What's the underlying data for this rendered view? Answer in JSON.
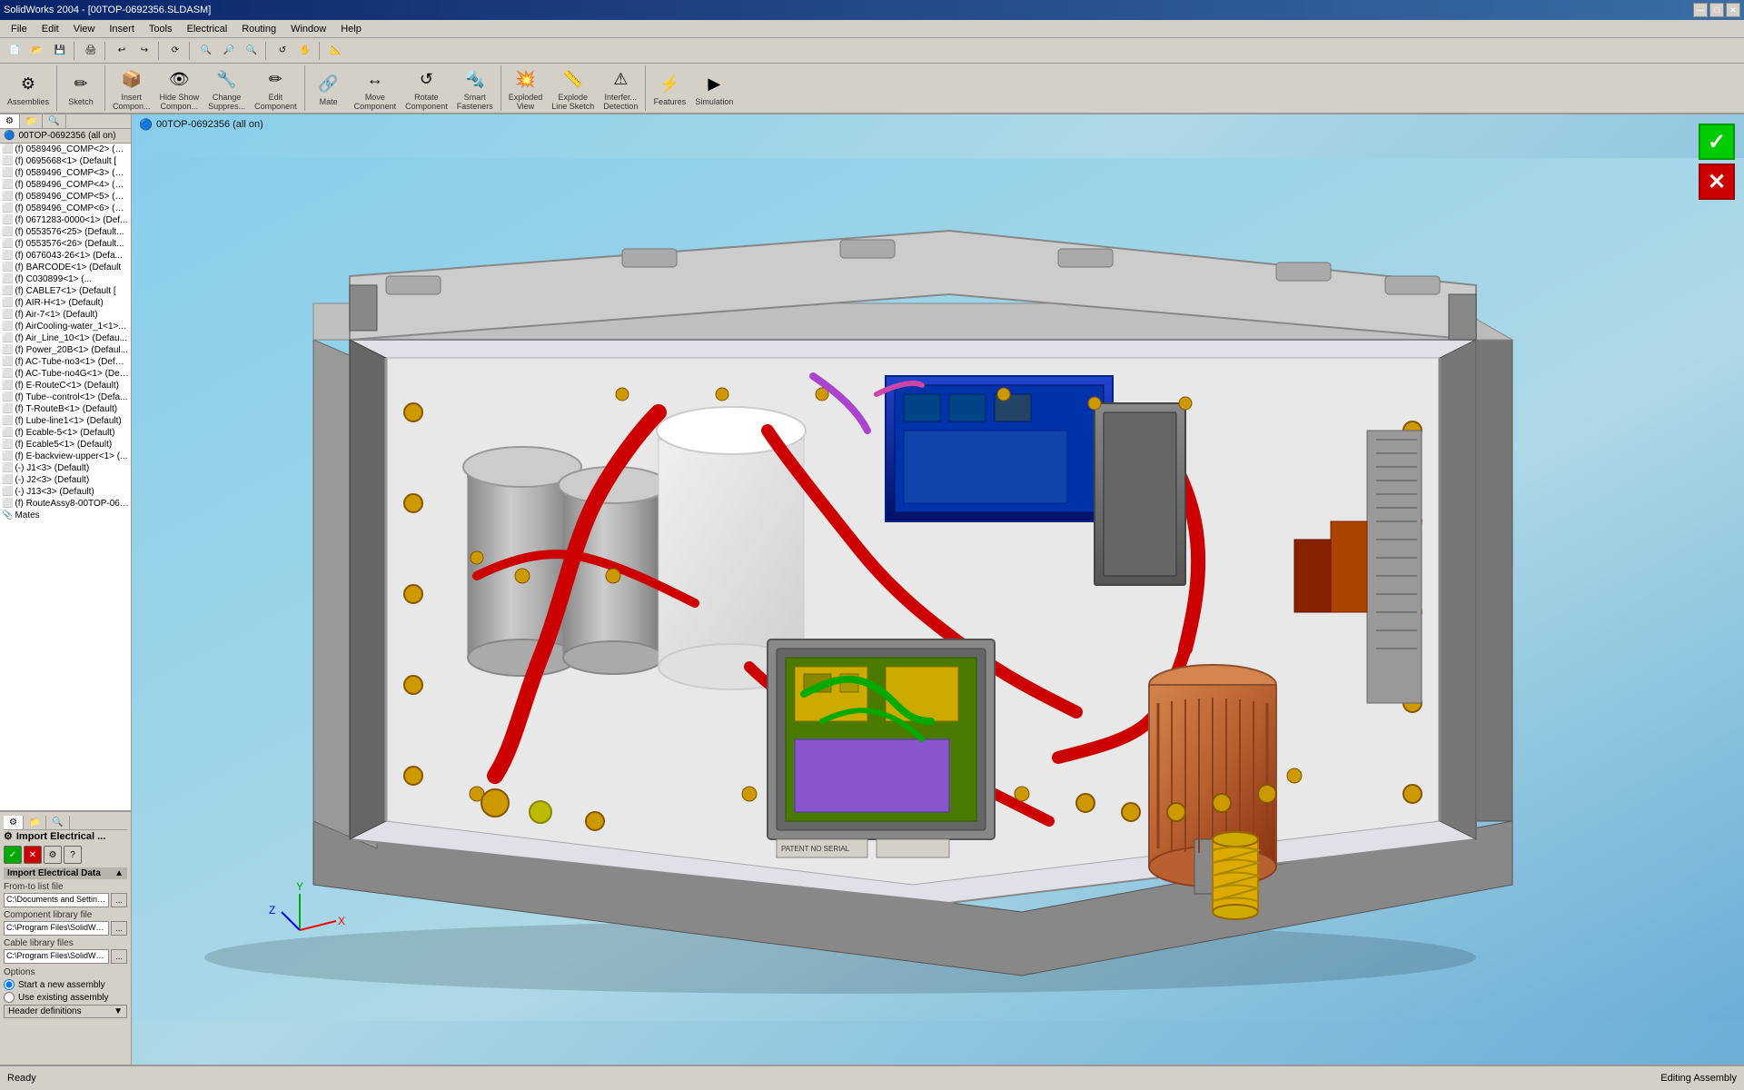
{
  "app": {
    "title": "SolidWorks 2004 - [00TOP-0692356.SLDASM]",
    "title_inner": "00TOP-0692356.SLDASM"
  },
  "titlebar": {
    "buttons": [
      "—",
      "□",
      "✕"
    ]
  },
  "menu": {
    "items": [
      "File",
      "Edit",
      "View",
      "Insert",
      "Tools",
      "Electrical",
      "Routing",
      "Window",
      "Help"
    ]
  },
  "toolbar2": {
    "tools": [
      {
        "label": "Assemblies",
        "icon": "⚙"
      },
      {
        "label": "Sketch",
        "icon": "✏"
      },
      {
        "label": "Insert\nCompon...",
        "icon": "📦"
      },
      {
        "label": "Hide/Show\nCompon...",
        "icon": "👁"
      },
      {
        "label": "Change\nSuppres...",
        "icon": "🔧"
      },
      {
        "label": "Edit\nComponent",
        "icon": "✏"
      },
      {
        "label": "Mate",
        "icon": "🔗"
      },
      {
        "label": "Move\nComponent",
        "icon": "↔"
      },
      {
        "label": "Rotate\nComponent",
        "icon": "↺"
      },
      {
        "label": "Smart\nFasteners",
        "icon": "🔩"
      },
      {
        "label": "Exploded\nView",
        "icon": "💥"
      },
      {
        "label": "Explode\nLine Sketch",
        "icon": "📏"
      },
      {
        "label": "Interfer...\nDetection",
        "icon": "⚠"
      },
      {
        "label": "Features",
        "icon": "⚡"
      },
      {
        "label": "Simulation",
        "icon": "▶"
      }
    ]
  },
  "feature_tree": {
    "root": "00TOP-0692356 (all on)",
    "items": [
      "(f) 0589496_COMP<2> (De...",
      "(f) 0695668<1> (Default [",
      "(f) 0589496_COMP<3> (De...",
      "(f) 0589496_COMP<4> (De...",
      "(f) 0589496_COMP<5> (De...",
      "(f) 0589496_COMP<6> (De...",
      "(f) 0671283-0000<1> (Def...",
      "(f) 0553576<25> (Default...",
      "(f) 0553576<26> (Default...",
      "(f) 0676043-26<1> (Defa...",
      "(f) BARCODE<1> (Default",
      "(f) C030899<1> (...",
      "(f) CABLE7<1> (Default [",
      "(f) AIR-H<1> (Default)",
      "(f) Air-7<1> (Default)",
      "(f) AirCooling-water_1<1>...",
      "(f) Air_Line_10<1> (Defau...",
      "(f) Power_20B<1> (Defaul...",
      "(f) AC-Tube-no3<1> (Defaul...",
      "(f) AC-Tube-no4G<1> (Def...",
      "(f) E-RouteC<1> (Default)",
      "(f) Tube--control<1> (Defa...",
      "(f) T-RouteB<1> (Default)",
      "(f) Lube-line1<1> (Default)",
      "(f) Ecable-5<1> (Default)",
      "(f) Ecable5<1> (Default)",
      "(f) E-backview-upper<1> (...",
      "(-) J1<3> (Default)",
      "(-) J2<3> (Default)",
      "(-) J13<3> (Default)",
      "(f) RouteAssy8-00TOP-069...",
      "Mates"
    ]
  },
  "tree_tabs": {
    "icons": [
      "⚙",
      "📁",
      "🔍"
    ]
  },
  "import_panel": {
    "title": "Import Electrical ...",
    "section": "Import Electrical Data",
    "fields": {
      "from_list_label": "From-to list file",
      "from_list_value": "C:\\Documents and Setting...",
      "component_lib_label": "Component library file",
      "component_lib_value": "C:\\Program Files\\SolidWor...",
      "cable_lib_label": "Cable library files",
      "cable_lib_value": "C:\\Program Files\\SolidWor..."
    },
    "options": {
      "label": "Options",
      "radio1": "Start a new assembly",
      "radio2": "Use existing assembly"
    },
    "header_def": "Header definitions",
    "buttons": {
      "check": "✓",
      "x": "✕",
      "gear": "⚙",
      "help": "?"
    }
  },
  "viewport": {
    "breadcrumb": "00TOP-0692356 (all on)"
  },
  "status_bar": {
    "left": "Ready",
    "right": "Editing Assembly"
  },
  "triad": {
    "x_label": "X",
    "y_label": "Y",
    "z_label": "Z"
  }
}
